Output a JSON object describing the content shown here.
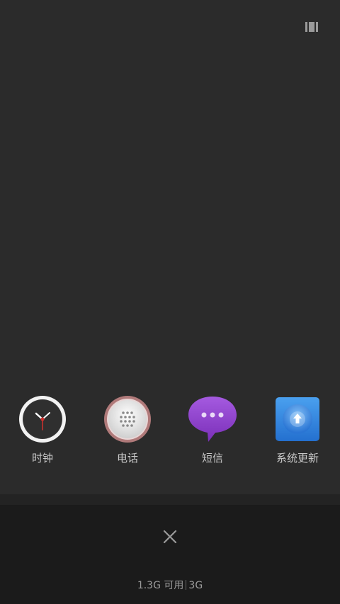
{
  "recent_apps": [
    {
      "label": "时钟",
      "icon": "clock-icon"
    },
    {
      "label": "电话",
      "icon": "phone-dialpad-icon"
    },
    {
      "label": "短信",
      "icon": "sms-bubble-icon"
    },
    {
      "label": "系统更新",
      "icon": "system-update-icon"
    }
  ],
  "memory": {
    "available": "1.3G 可用",
    "network": "3G"
  },
  "icons": {
    "view_toggle": "view-mode-icon",
    "close": "close-icon"
  },
  "colors": {
    "background": "#2b2b2b",
    "panel": "#1b1b1b",
    "sms_purple": "#8a3fc4",
    "update_blue": "#2f7fd6"
  }
}
